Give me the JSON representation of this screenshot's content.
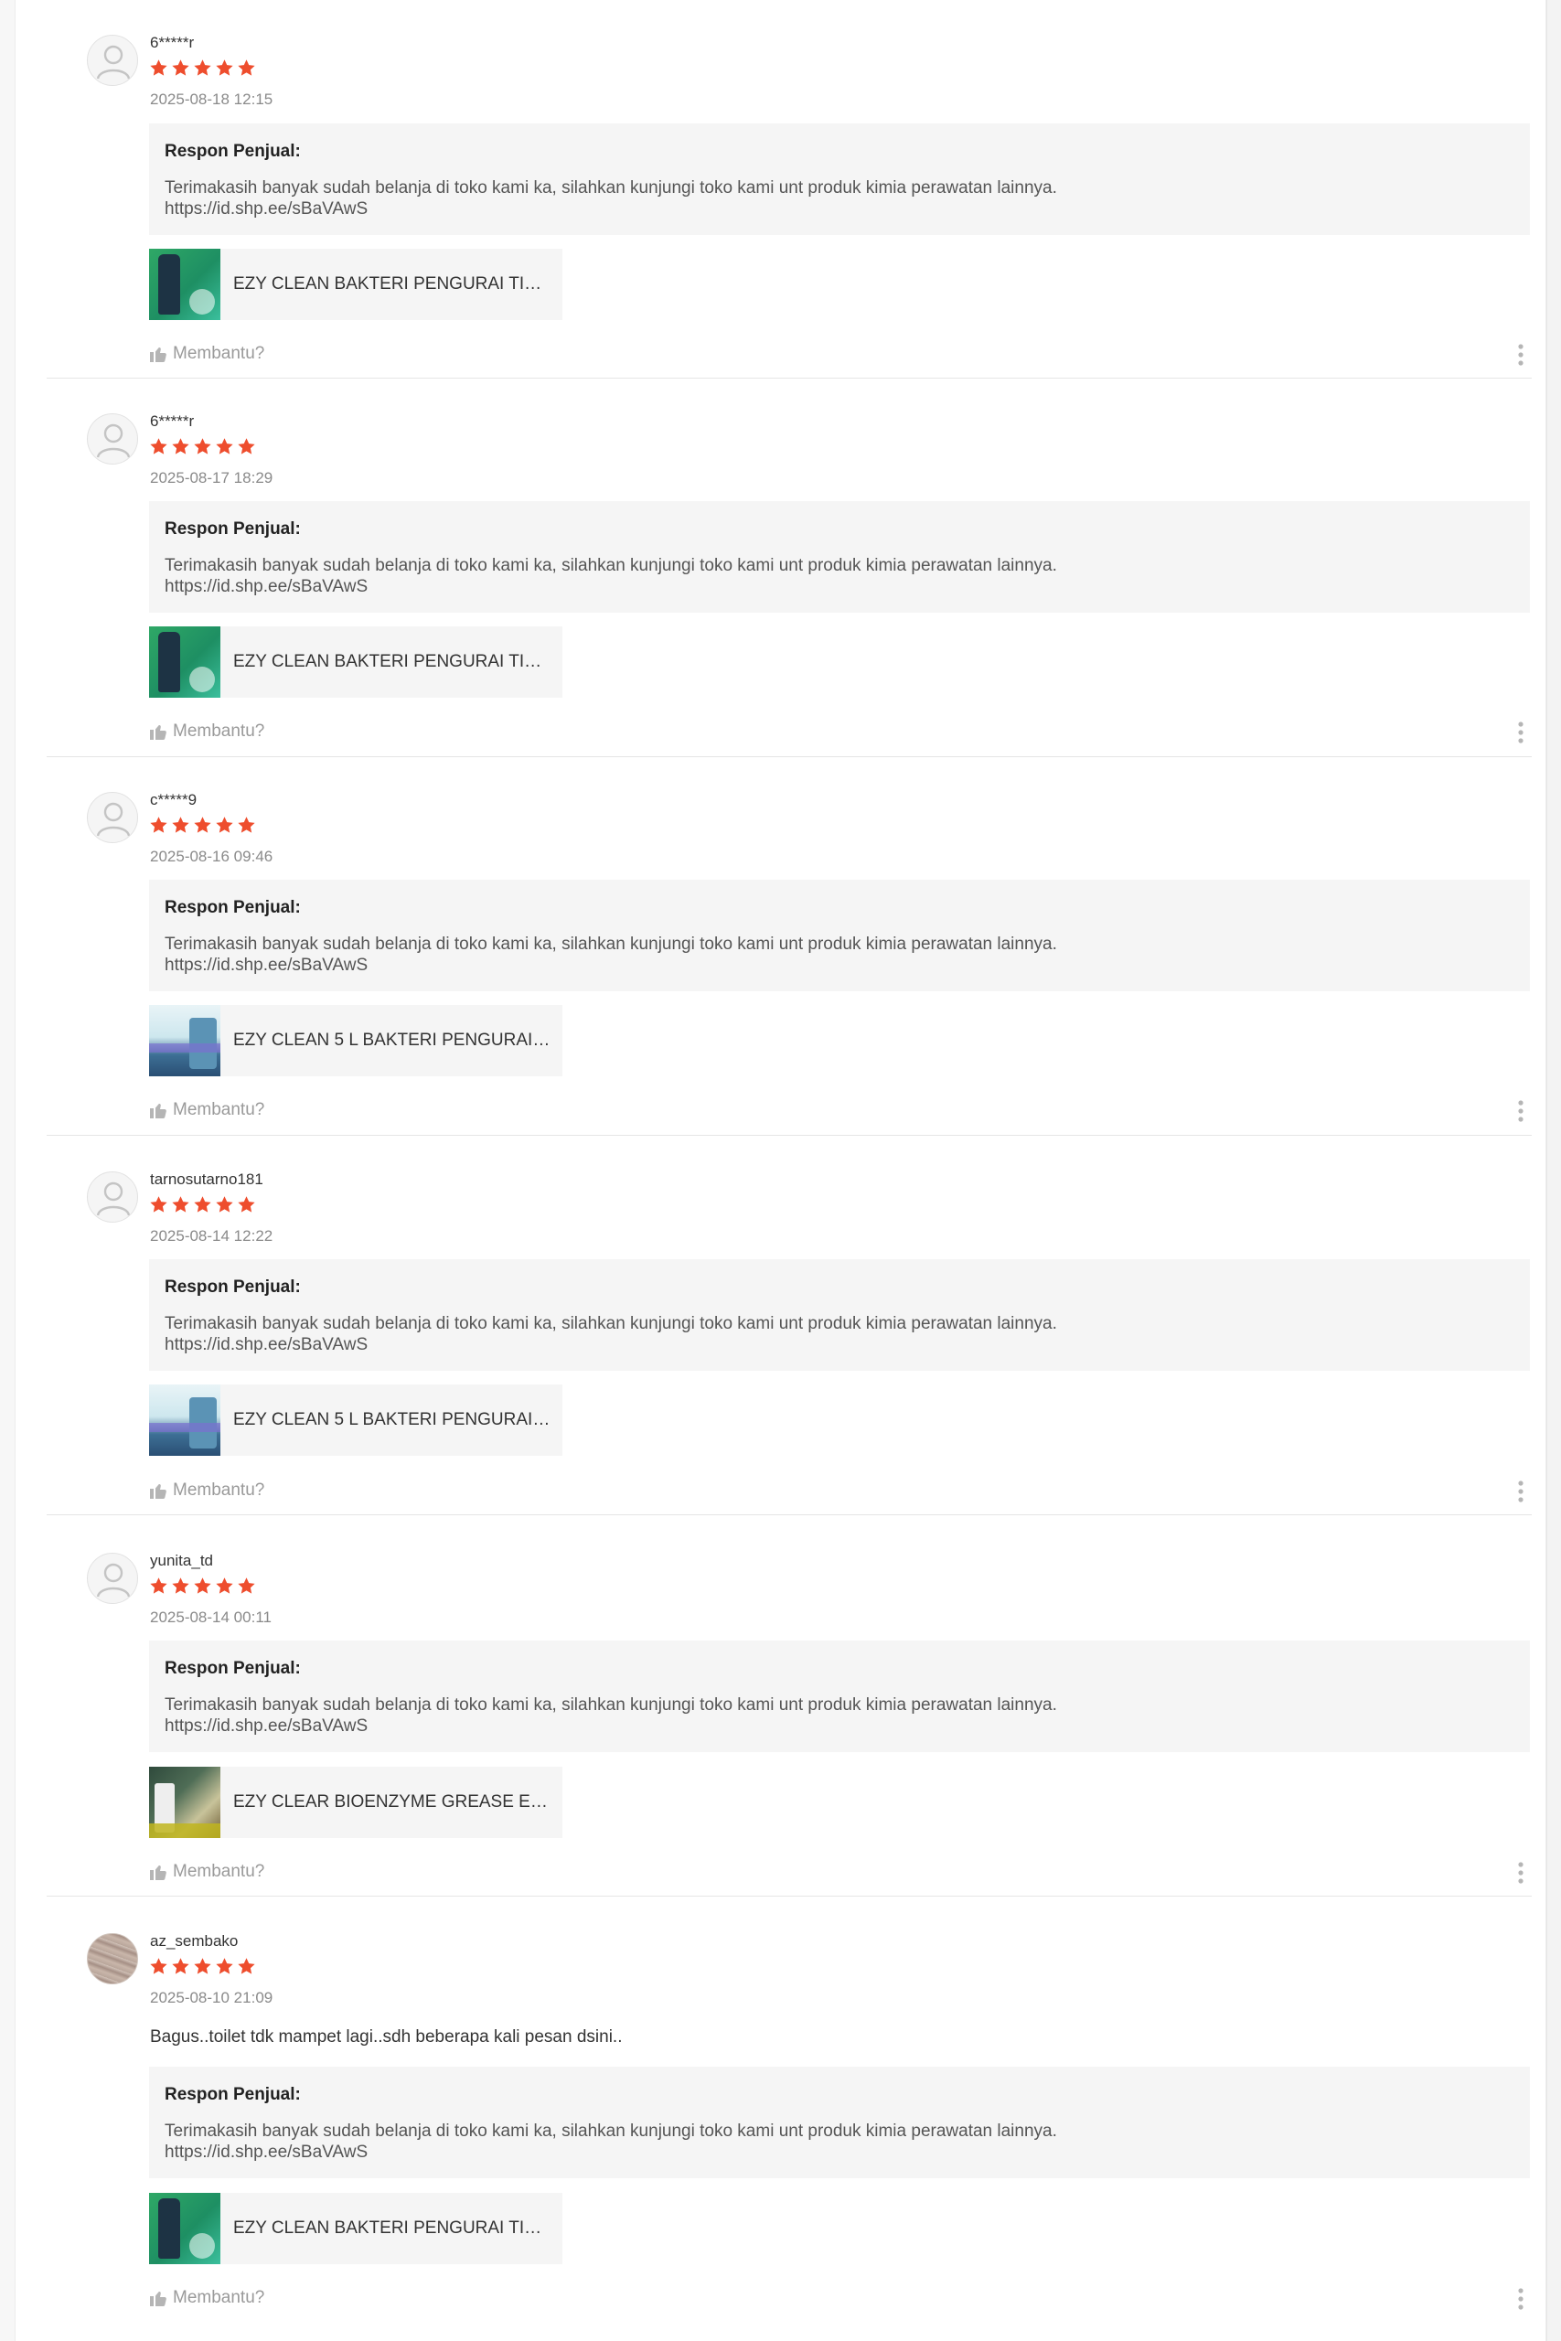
{
  "colors": {
    "star": "#ee4d2d",
    "muted": "#9a9a9a",
    "panel": "#f5f5f5"
  },
  "icons": {
    "avatar": "user-placeholder-icon",
    "star": "star-icon",
    "helpful": "thumbs-up-icon",
    "more": "more-vertical-icon"
  },
  "reviews": [
    {
      "username": "6*****r",
      "rating": 5,
      "date": "2025-08-18 12:15",
      "comment": "",
      "response_title": "Respon Penjual:",
      "response_text": "Terimakasih banyak sudah belanja di toko kami ka, silahkan kunjungi toko kami unt produk kimia perawatan lainnya.\n https://id.shp.ee/sBaVAwS",
      "product_name": "EZY CLEAN BAKTERI PENGURAI TINJ...",
      "helpful_label": "Membantu?"
    },
    {
      "username": "6*****r",
      "rating": 5,
      "date": "2025-08-17 18:29",
      "comment": "",
      "response_title": "Respon Penjual:",
      "response_text": "Terimakasih banyak sudah belanja di toko kami ka, silahkan kunjungi toko kami unt produk kimia perawatan lainnya.\n https://id.shp.ee/sBaVAwS",
      "product_name": "EZY CLEAN BAKTERI PENGURAI TINJ...",
      "helpful_label": "Membantu?"
    },
    {
      "username": "c*****9",
      "rating": 5,
      "date": "2025-08-16 09:46",
      "comment": "",
      "response_title": "Respon Penjual:",
      "response_text": "Terimakasih banyak sudah belanja di toko kami ka, silahkan kunjungi toko kami unt produk kimia perawatan lainnya.\n https://id.shp.ee/sBaVAwS",
      "product_name": "EZY CLEAN 5 L BAKTERI PENGURAI T...",
      "helpful_label": "Membantu?"
    },
    {
      "username": "tarnosutarno181",
      "rating": 5,
      "date": "2025-08-14 12:22",
      "comment": "",
      "response_title": "Respon Penjual:",
      "response_text": "Terimakasih banyak sudah belanja di toko kami ka, silahkan kunjungi toko kami unt produk kimia perawatan lainnya.\n https://id.shp.ee/sBaVAwS",
      "product_name": "EZY CLEAN 5 L BAKTERI PENGURAI T...",
      "helpful_label": "Membantu?"
    },
    {
      "username": "yunita_td",
      "rating": 5,
      "date": "2025-08-14 00:11",
      "comment": "",
      "response_title": "Respon Penjual:",
      "response_text": "Terimakasih banyak sudah belanja di toko kami ka, silahkan kunjungi toko kami unt produk kimia perawatan lainnya.\n https://id.shp.ee/sBaVAwS",
      "product_name": "EZY CLEAR BIOENZYME GREASE EAT...",
      "helpful_label": "Membantu?"
    },
    {
      "username": "az_sembako",
      "rating": 5,
      "date": "2025-08-10 21:09",
      "comment": "Bagus..toilet tdk mampet lagi..sdh beberapa kali pesan dsini..",
      "response_title": "Respon Penjual:",
      "response_text": "Terimakasih banyak sudah belanja di toko kami ka, silahkan kunjungi toko kami unt produk kimia perawatan lainnya.\n https://id.shp.ee/sBaVAwS",
      "product_name": "EZY CLEAN BAKTERI PENGURAI TINJ...",
      "helpful_label": "Membantu?"
    }
  ]
}
